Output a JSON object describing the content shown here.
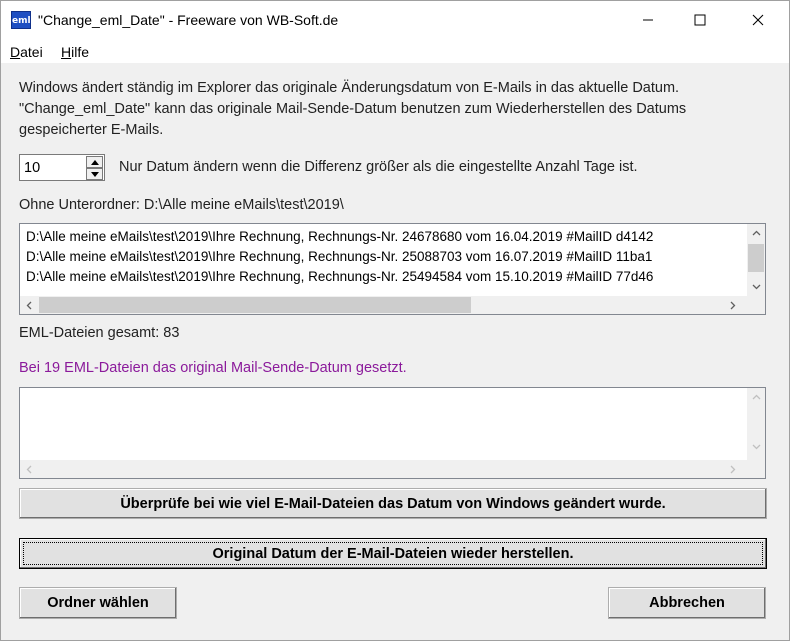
{
  "window": {
    "icon_text": "eml",
    "title": "\"Change_eml_Date\" - Freeware von WB-Soft.de"
  },
  "menu": {
    "file_accel": "D",
    "file_rest": "atei",
    "help_accel": "H",
    "help_rest": "ilfe"
  },
  "intro": {
    "line1": "Windows ändert ständig im Explorer das originale Änderungsdatum von E-Mails in das aktuelle Datum.",
    "line2": "\"Change_eml_Date\"  kann das originale Mail-Sende-Datum benutzen zum Wiederherstellen des Datums",
    "line3": "gespeicherter E-Mails."
  },
  "days": {
    "value": "10",
    "label": "Nur Datum ändern wenn die Differenz größer als die eingestellte Anzahl Tage ist."
  },
  "folder_label": "Ohne Unterordner: D:\\Alle meine eMails\\test\\2019\\",
  "file_list": [
    "D:\\Alle meine eMails\\test\\2019\\Ihre Rechnung, Rechnungs-Nr. 24678680 vom 16.04.2019 #MailID d4142",
    "D:\\Alle meine eMails\\test\\2019\\Ihre Rechnung, Rechnungs-Nr. 25088703 vom 16.07.2019 #MailID 11ba1",
    "D:\\Alle meine eMails\\test\\2019\\Ihre Rechnung, Rechnungs-Nr. 25494584 vom 15.10.2019 #MailID 77d46"
  ],
  "eml_total": "EML-Dateien gesamt: 83",
  "result_text": "Bei 19 EML-Dateien das original Mail-Sende-Datum gesetzt.",
  "colors": {
    "result_text": "#8b1a9b"
  },
  "buttons": {
    "check": "Überprüfe bei wie viel E-Mail-Dateien das Datum von Windows geändert wurde.",
    "restore": "Original Datum der E-Mail-Dateien wieder herstellen.",
    "choose_folder": "Ordner wählen",
    "cancel": "Abbrechen"
  }
}
